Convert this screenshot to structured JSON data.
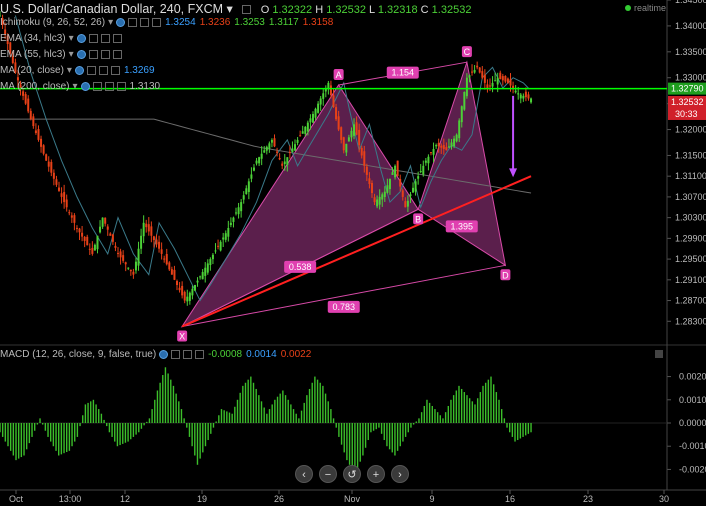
{
  "header": {
    "title": "U.S. Dollar/Canadian Dollar, 240, FXCM",
    "ohlc": {
      "o_label": "O",
      "o": "1.32322",
      "h_label": "H",
      "h": "1.32532",
      "l_label": "L",
      "l": "1.32318",
      "c_label": "C",
      "c": "1.32532"
    },
    "realtime": "realtime"
  },
  "indicators": [
    {
      "label": "Ichimoku (9, 26, 52, 26)",
      "values": [
        "1.3254",
        "1.3236",
        "1.3253",
        "1.3117",
        "1.3158"
      ],
      "colors": [
        "#3aa0ff",
        "#e84118",
        "#4cd137",
        "#4cd137",
        "#e84118"
      ]
    },
    {
      "label": "EMA (34, hlc3)",
      "values": [],
      "colors": []
    },
    {
      "label": "EMA (55, hlc3)",
      "values": [],
      "colors": []
    },
    {
      "label": "MA (20, close)",
      "values": [
        "1.3269"
      ],
      "colors": [
        "#3aa0ff"
      ]
    },
    {
      "label": "MA (200, close)",
      "values": [
        "1.3130"
      ],
      "colors": [
        "#bbbbbb"
      ]
    }
  ],
  "macd": {
    "label": "MACD (12, 26, close, 9, false, true)",
    "values": [
      "-0.0008",
      "0.0014",
      "0.0022"
    ],
    "colors": [
      "#4cd137",
      "#3aa0ff",
      "#e84118"
    ]
  },
  "colors": {
    "bg": "#000000",
    "up": "#4cd137",
    "down": "#e84118",
    "pattern": "#7a2a66",
    "pattern_line": "#d84aa8",
    "trend": "#ff2020",
    "hline": "#00ff00",
    "grid": "#1a1a1a",
    "ma": "#6c6c6c"
  },
  "chart_data": {
    "type": "candlestick",
    "x_ticks": [
      "Oct",
      "13:00",
      "12",
      "19",
      "26",
      "Nov",
      "9",
      "16",
      "23",
      "30"
    ],
    "price_ylim": [
      1.279,
      1.345
    ],
    "price_ticks": [
      "1.34500",
      "1.34000",
      "1.33500",
      "1.33000",
      "1.32500",
      "1.32000",
      "1.31500",
      "1.31100",
      "1.30700",
      "1.30300",
      "1.29900",
      "1.29500",
      "1.29100",
      "1.28700",
      "1.28300"
    ],
    "last_price": "1.32532",
    "hline_price": "1.32790",
    "countdown": "30:33",
    "close_path": [
      [
        0,
        1.342
      ],
      [
        6,
        1.331
      ],
      [
        12,
        1.322
      ],
      [
        18,
        1.314
      ],
      [
        24,
        1.307
      ],
      [
        30,
        1.301
      ],
      [
        36,
        1.296
      ],
      [
        40,
        1.303
      ],
      [
        46,
        1.296
      ],
      [
        52,
        1.292
      ],
      [
        56,
        1.302
      ],
      [
        62,
        1.297
      ],
      [
        68,
        1.291
      ],
      [
        72,
        1.287
      ],
      [
        76,
        1.29
      ],
      [
        82,
        1.295
      ],
      [
        88,
        1.3
      ],
      [
        94,
        1.306
      ],
      [
        100,
        1.314
      ],
      [
        106,
        1.318
      ],
      [
        110,
        1.313
      ],
      [
        116,
        1.318
      ],
      [
        122,
        1.323
      ],
      [
        128,
        1.329
      ],
      [
        131,
        1.322
      ],
      [
        134,
        1.316
      ],
      [
        138,
        1.321
      ],
      [
        142,
        1.313
      ],
      [
        146,
        1.306
      ],
      [
        150,
        1.308
      ],
      [
        154,
        1.313
      ],
      [
        158,
        1.305
      ],
      [
        162,
        1.31
      ],
      [
        166,
        1.314
      ],
      [
        170,
        1.317
      ],
      [
        174,
        1.316
      ],
      [
        178,
        1.319
      ],
      [
        182,
        1.33
      ],
      [
        186,
        1.332
      ],
      [
        190,
        1.328
      ],
      [
        194,
        1.33
      ],
      [
        198,
        1.329
      ],
      [
        202,
        1.327
      ],
      [
        206,
        1.326
      ]
    ],
    "harmonic": {
      "points": [
        {
          "label": "X",
          "i": 71,
          "p": 1.282
        },
        {
          "label": "A",
          "i": 132,
          "p": 1.3286
        },
        {
          "label": "B",
          "i": 163,
          "p": 1.3046
        },
        {
          "label": "C",
          "i": 182,
          "p": 1.333
        },
        {
          "label": "D",
          "i": 197,
          "p": 1.2938
        }
      ],
      "ratios": [
        {
          "label": "1.154",
          "between": [
            "A",
            "C"
          ]
        },
        {
          "label": "0.538",
          "between": [
            "X",
            "B"
          ]
        },
        {
          "label": "1.395",
          "between": [
            "B",
            "D"
          ]
        },
        {
          "label": "0.783",
          "between": [
            "X",
            "D"
          ]
        }
      ]
    },
    "macd_ylim": [
      -0.0028,
      0.0028
    ],
    "macd_ticks": [
      "0.0020",
      "0.0010",
      "0.0000",
      "-0.0010",
      "-0.0020"
    ],
    "macd_hist": [
      [
        0,
        -0.0004
      ],
      [
        3,
        -0.001
      ],
      [
        6,
        -0.0016
      ],
      [
        9,
        -0.0014
      ],
      [
        12,
        -0.0006
      ],
      [
        15,
        0.0002
      ],
      [
        18,
        -0.0006
      ],
      [
        22,
        -0.0014
      ],
      [
        26,
        -0.0012
      ],
      [
        29,
        -0.0006
      ],
      [
        32,
        0.0008
      ],
      [
        35,
        0.001
      ],
      [
        38,
        0.0004
      ],
      [
        41,
        -0.0004
      ],
      [
        44,
        -0.001
      ],
      [
        48,
        -0.0008
      ],
      [
        52,
        -0.0004
      ],
      [
        56,
        0.0002
      ],
      [
        59,
        0.0014
      ],
      [
        62,
        0.0024
      ],
      [
        65,
        0.0016
      ],
      [
        68,
        0.0006
      ],
      [
        71,
        -0.0006
      ],
      [
        74,
        -0.0018
      ],
      [
        77,
        -0.001
      ],
      [
        80,
        -0.0002
      ],
      [
        83,
        0.0006
      ],
      [
        87,
        0.0004
      ],
      [
        91,
        0.0016
      ],
      [
        94,
        0.002
      ],
      [
        97,
        0.0012
      ],
      [
        100,
        0.0004
      ],
      [
        103,
        0.001
      ],
      [
        106,
        0.0014
      ],
      [
        109,
        0.0008
      ],
      [
        112,
        0.0002
      ],
      [
        115,
        0.0012
      ],
      [
        118,
        0.002
      ],
      [
        121,
        0.0016
      ],
      [
        124,
        0.0006
      ],
      [
        127,
        -0.0006
      ],
      [
        130,
        -0.0016
      ],
      [
        133,
        -0.0022
      ],
      [
        136,
        -0.0014
      ],
      [
        139,
        -0.0004
      ],
      [
        142,
        -0.0002
      ],
      [
        145,
        -0.001
      ],
      [
        148,
        -0.0014
      ],
      [
        151,
        -0.0008
      ],
      [
        154,
        -0.0002
      ],
      [
        157,
        0.0002
      ],
      [
        160,
        0.001
      ],
      [
        163,
        0.0006
      ],
      [
        166,
        0.0002
      ],
      [
        169,
        0.001
      ],
      [
        172,
        0.0016
      ],
      [
        175,
        0.0012
      ],
      [
        178,
        0.0008
      ],
      [
        181,
        0.0016
      ],
      [
        184,
        0.002
      ],
      [
        187,
        0.001
      ],
      [
        190,
        -0.0002
      ],
      [
        193,
        -0.0008
      ],
      [
        196,
        -0.0006
      ],
      [
        199,
        -0.0004
      ]
    ]
  },
  "nav": {
    "buttons": [
      {
        "name": "nav-back-button",
        "glyph": "‹"
      },
      {
        "name": "zoom-out-button",
        "glyph": "−"
      },
      {
        "name": "reset-button",
        "glyph": "↺"
      },
      {
        "name": "zoom-in-button",
        "glyph": "+"
      },
      {
        "name": "nav-forward-button",
        "glyph": "›"
      }
    ]
  }
}
